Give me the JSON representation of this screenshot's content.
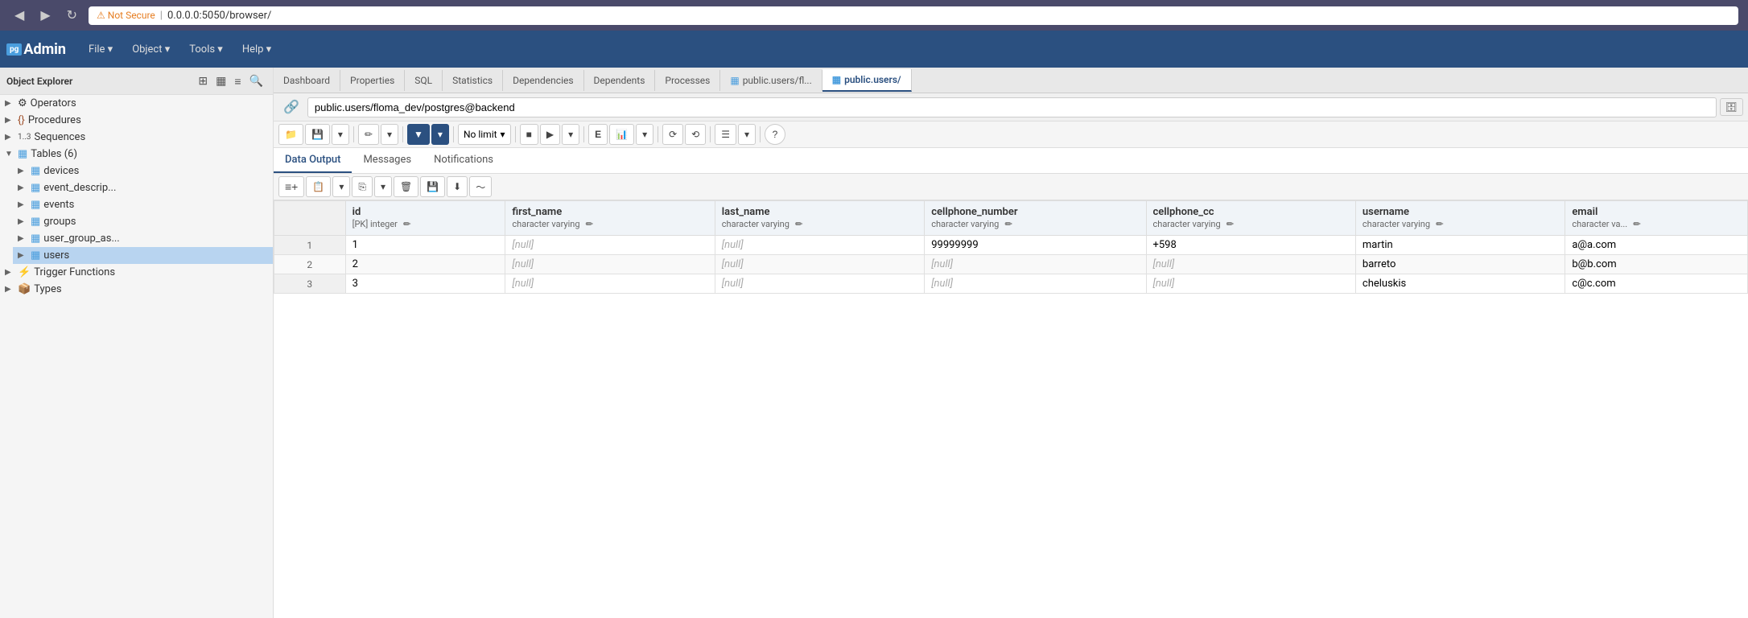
{
  "browser": {
    "nav_back": "◀",
    "nav_forward": "▶",
    "nav_refresh": "↻",
    "not_secure_label": "⚠ Not Secure",
    "separator": "|",
    "url": "0.0.0.0:5050/browser/"
  },
  "header": {
    "logo": "pgAdmin",
    "logo_pg": "pg",
    "logo_admin": "Admin",
    "menus": [
      "File ▾",
      "Object ▾",
      "Tools ▾",
      "Help ▾"
    ]
  },
  "sidebar": {
    "title": "Object Explorer",
    "items": [
      {
        "label": "Operators",
        "indent": 0,
        "icon": "⚙",
        "expanded": false
      },
      {
        "label": "Procedures",
        "indent": 0,
        "icon": "{}",
        "expanded": false
      },
      {
        "label": "Sequences",
        "indent": 0,
        "icon": "1..3",
        "expanded": false
      },
      {
        "label": "Tables (6)",
        "indent": 0,
        "icon": "▦",
        "expanded": true
      },
      {
        "label": "devices",
        "indent": 1,
        "icon": "▦",
        "expanded": false
      },
      {
        "label": "event_descrip...",
        "indent": 1,
        "icon": "▦",
        "expanded": false
      },
      {
        "label": "events",
        "indent": 1,
        "icon": "▦",
        "expanded": false
      },
      {
        "label": "groups",
        "indent": 1,
        "icon": "▦",
        "expanded": false
      },
      {
        "label": "user_group_as...",
        "indent": 1,
        "icon": "▦",
        "expanded": false
      },
      {
        "label": "users",
        "indent": 1,
        "icon": "▦",
        "expanded": false,
        "selected": true
      },
      {
        "label": "Trigger Functions",
        "indent": 0,
        "icon": "⚡",
        "expanded": false
      },
      {
        "label": "Types",
        "indent": 0,
        "icon": "📦",
        "expanded": false
      }
    ]
  },
  "tabs": [
    {
      "label": "Dashboard",
      "active": false
    },
    {
      "label": "Properties",
      "active": false
    },
    {
      "label": "SQL",
      "active": false
    },
    {
      "label": "Statistics",
      "active": false
    },
    {
      "label": "Dependencies",
      "active": false
    },
    {
      "label": "Dependents",
      "active": false
    },
    {
      "label": "Processes",
      "active": false
    },
    {
      "label": "public.users/fl...",
      "active": false,
      "icon": "▦"
    },
    {
      "label": "public.users/",
      "active": true,
      "icon": "▦"
    }
  ],
  "query_bar": {
    "connection": "public.users/floma_dev/postgres@backend",
    "db_icon": "🗄"
  },
  "toolbar": {
    "buttons": [
      {
        "id": "folder",
        "label": "📁",
        "dropdown": false
      },
      {
        "id": "save",
        "label": "💾",
        "dropdown": true
      },
      {
        "id": "edit",
        "label": "✏",
        "dropdown": true
      },
      {
        "id": "filter",
        "label": "▼",
        "dropdown": true,
        "active": true
      },
      {
        "id": "limit",
        "label": "No limit",
        "dropdown": true
      },
      {
        "id": "stop",
        "label": "■",
        "dropdown": false
      },
      {
        "id": "run",
        "label": "▶",
        "dropdown": true
      },
      {
        "id": "explain",
        "label": "E",
        "dropdown": false
      },
      {
        "id": "explain-analyze",
        "label": "📊",
        "dropdown": true
      },
      {
        "id": "commit",
        "label": "⟳",
        "dropdown": false
      },
      {
        "id": "rollback",
        "label": "⟲",
        "dropdown": false
      },
      {
        "id": "macros",
        "label": "☰",
        "dropdown": true
      },
      {
        "id": "help",
        "label": "?",
        "dropdown": false
      }
    ]
  },
  "sub_tabs": [
    {
      "label": "Data Output",
      "active": true
    },
    {
      "label": "Messages",
      "active": false
    },
    {
      "label": "Notifications",
      "active": false
    }
  ],
  "data_toolbar": {
    "buttons": [
      {
        "id": "add-row",
        "label": "➕",
        "symbol": "≡+"
      },
      {
        "id": "copy",
        "label": "📋",
        "dropdown": false
      },
      {
        "id": "copy-dd",
        "label": "▾",
        "dropdown": true
      },
      {
        "id": "paste",
        "label": "📋",
        "symbol": "⎘"
      },
      {
        "id": "paste-dd",
        "label": "▾",
        "dropdown": true
      },
      {
        "id": "delete",
        "label": "🗑",
        "symbol": "✕"
      },
      {
        "id": "save-data",
        "label": "💾",
        "symbol": "🗄"
      },
      {
        "id": "download",
        "label": "⬇"
      },
      {
        "id": "graph",
        "label": "~"
      }
    ]
  },
  "table": {
    "columns": [
      {
        "name": "id",
        "type": "[PK] integer",
        "editable": true
      },
      {
        "name": "first_name",
        "type": "character varying",
        "editable": true
      },
      {
        "name": "last_name",
        "type": "character varying",
        "editable": true
      },
      {
        "name": "cellphone_number",
        "type": "character varying",
        "editable": true
      },
      {
        "name": "cellphone_cc",
        "type": "character varying",
        "editable": true
      },
      {
        "name": "username",
        "type": "character varying",
        "editable": true
      },
      {
        "name": "email",
        "type": "character va...",
        "editable": true
      }
    ],
    "rows": [
      {
        "row_num": "1",
        "id": "1",
        "first_name": null,
        "last_name": null,
        "cellphone_number": "99999999",
        "cellphone_cc": "+598",
        "username": "martin",
        "email": "a@a.com"
      },
      {
        "row_num": "2",
        "id": "2",
        "first_name": null,
        "last_name": null,
        "cellphone_number": null,
        "cellphone_cc": null,
        "username": "barreto",
        "email": "b@b.com"
      },
      {
        "row_num": "3",
        "id": "3",
        "first_name": null,
        "last_name": null,
        "cellphone_number": null,
        "cellphone_cc": null,
        "username": "cheluskis",
        "email": "c@c.com"
      }
    ],
    "null_label": "[null]"
  }
}
